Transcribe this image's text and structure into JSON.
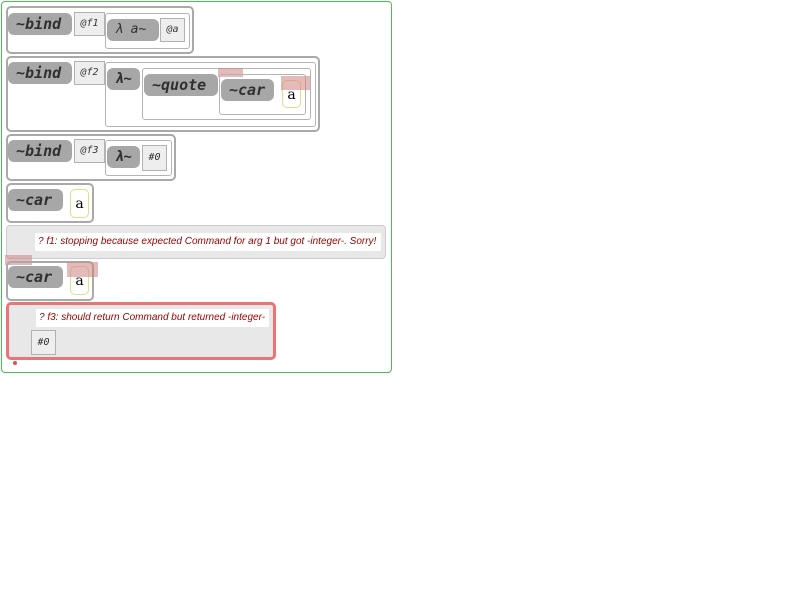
{
  "statements": [
    {
      "keyword": "~bind",
      "param": "@f1",
      "lambda": "λ a~",
      "arg": "@a"
    },
    {
      "keyword": "~bind",
      "param": "@f2",
      "lambda": "λ~",
      "quote": "~quote",
      "car": "~car",
      "string": "a"
    },
    {
      "keyword": "~bind",
      "param": "@f3",
      "lambda": "λ~",
      "value": "#0"
    },
    {
      "keyword": "~car",
      "string": "a"
    }
  ],
  "errors": {
    "f1": "? f1: stopping because expected Command for arg 1 but got -integer-. Sorry!",
    "f3": "? f3: should return Command but returned -integer-"
  },
  "result": {
    "keyword": "~car",
    "string": "a",
    "fail_value": "#0"
  },
  "colors": {
    "frame": "#4cbb5a",
    "block_border": "#a9a9a9",
    "keyword_bg": "#a7a7a7",
    "error_text": "#990000",
    "fail_border": "#ed7474",
    "string_border": "#e2dd8a",
    "marker": "#e35050"
  }
}
